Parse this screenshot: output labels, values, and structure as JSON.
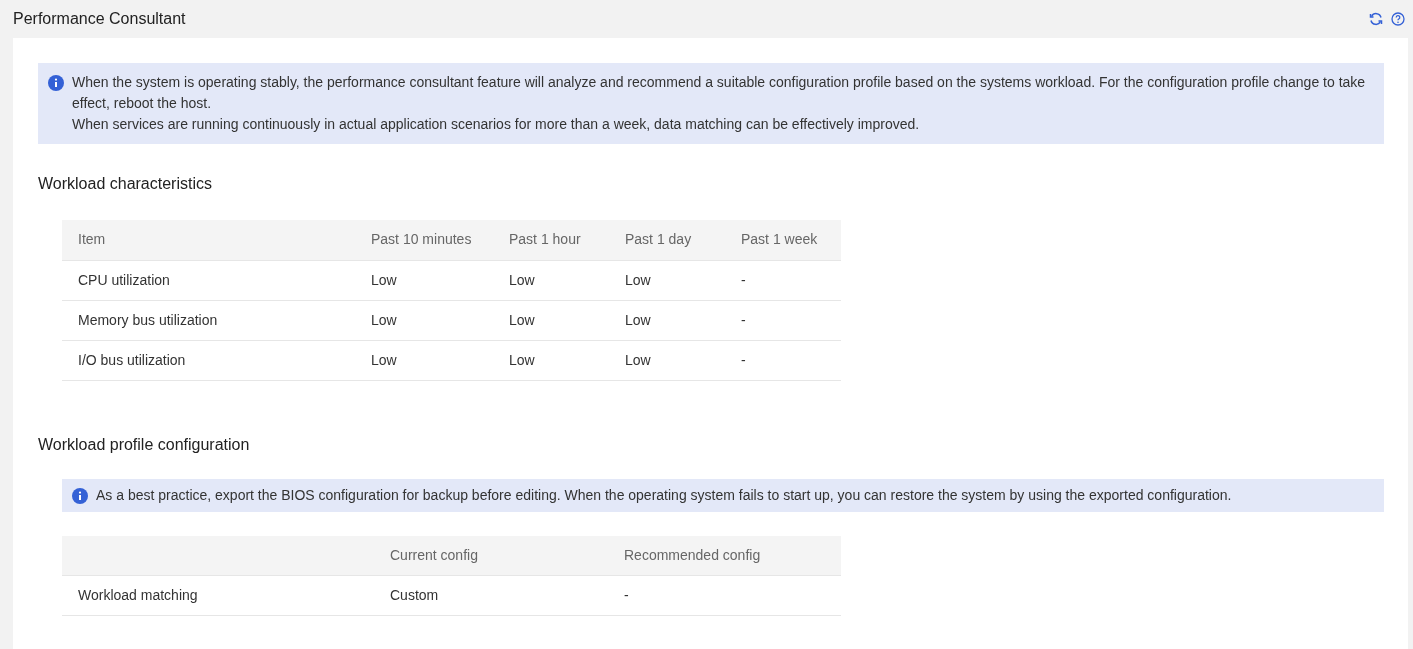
{
  "page": {
    "title": "Performance Consultant"
  },
  "notice": {
    "lines": [
      "When the system is operating stably, the performance consultant feature will analyze and recommend a suitable configuration profile based on the systems workload. For the configuration profile change to take effect, reboot the host.",
      "When services are running continuously in actual application scenarios for more than a week, data matching can be effectively improved."
    ]
  },
  "workload_characteristics": {
    "heading": "Workload characteristics",
    "columns": [
      "Item",
      "Past 10 minutes",
      "Past 1 hour",
      "Past 1 day",
      "Past 1 week"
    ],
    "rows": [
      [
        "CPU utilization",
        "Low",
        "Low",
        "Low",
        "-"
      ],
      [
        "Memory bus utilization",
        "Low",
        "Low",
        "Low",
        "-"
      ],
      [
        "I/O bus utilization",
        "Low",
        "Low",
        "Low",
        "-"
      ]
    ]
  },
  "workload_profile": {
    "heading": "Workload profile configuration",
    "notice": "As a best practice, export the BIOS configuration for backup before editing. When the operating system fails to start up, you can restore the system by using the exported configuration.",
    "columns": [
      "",
      "Current config",
      "Recommended config"
    ],
    "rows": [
      [
        "Workload matching",
        "Custom",
        "-"
      ]
    ]
  }
}
